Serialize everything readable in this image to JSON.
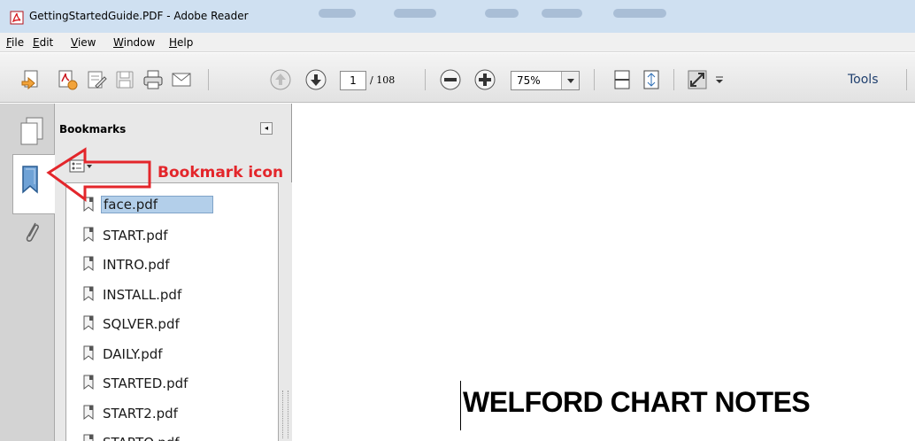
{
  "window": {
    "title": "GettingStartedGuide.PDF - Adobe Reader"
  },
  "menu": {
    "items": [
      {
        "accel": "F",
        "rest": "ile"
      },
      {
        "accel": "E",
        "rest": "dit"
      },
      {
        "accel": "V",
        "rest": "iew"
      },
      {
        "accel": "W",
        "rest": "indow"
      },
      {
        "accel": "H",
        "rest": "elp"
      }
    ]
  },
  "toolbar": {
    "page_current": "1",
    "page_total": "/ 108",
    "zoom": "75%",
    "tools_label": "Tools"
  },
  "bookmarks": {
    "title": "Bookmarks",
    "items": [
      {
        "label": "face.pdf",
        "selected": true
      },
      {
        "label": "START.pdf"
      },
      {
        "label": "INTRO.pdf"
      },
      {
        "label": "INSTALL.pdf"
      },
      {
        "label": "SQLVER.pdf"
      },
      {
        "label": "DAILY.pdf"
      },
      {
        "label": "STARTED.pdf"
      },
      {
        "label": "START2.pdf"
      },
      {
        "label": "STARTO.pdf"
      }
    ]
  },
  "annotation": {
    "label": "Bookmark icon",
    "color": "#e3262b"
  },
  "document": {
    "heading": "WELFORD CHART NOTES"
  }
}
